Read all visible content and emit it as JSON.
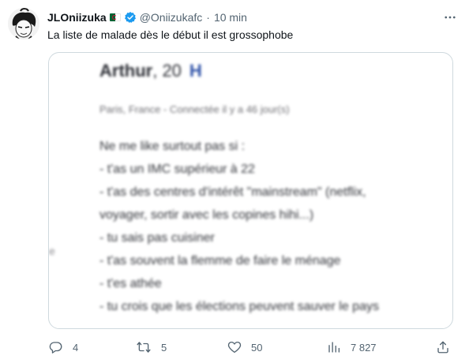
{
  "tweet": {
    "display_name": "JLOniizuka",
    "handle": "@Oniizukafc",
    "separator": "·",
    "time": "10 min",
    "text": "La liste de malade dès le début il est grossophobe",
    "icons": {
      "avatar": "avatar",
      "flag": "flag-algeria-icon",
      "verified": "verified-badge-icon",
      "more": "more-icon"
    }
  },
  "media": {
    "profile_name": "Arthur",
    "profile_age": ", 20",
    "profile_badge": "H",
    "location": "Paris, France - Connectée il y a 46 jour(s)",
    "lines": [
      "Ne me like surtout pas si :",
      "- t'as un IMC supérieur à 22",
      "- t'as des centres d'intérêt \"mainstream\" (netflix,",
      "voyager, sortir avec les copines hihi...)",
      "- tu sais pas cuisiner",
      "- t'as souvent la flemme de faire le ménage",
      "- t'es athée",
      "- tu crois que les élections peuvent sauver le pays"
    ],
    "edge_char": "e"
  },
  "actions": {
    "reply_count": "4",
    "retweet_count": "5",
    "like_count": "50",
    "views_count": "7 827",
    "icons": [
      "reply-icon",
      "retweet-icon",
      "like-icon",
      "views-icon",
      "share-icon"
    ]
  },
  "colors": {
    "text": "#0f1419",
    "secondary": "#536471",
    "verified": "#1d9bf0",
    "border": "#cfd9de"
  }
}
